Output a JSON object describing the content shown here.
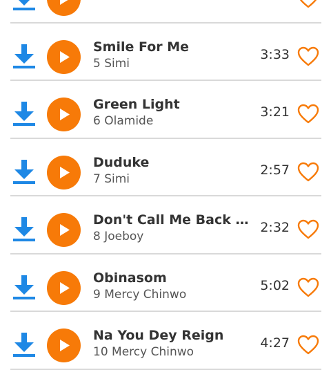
{
  "colors": {
    "accent": "#f77a08",
    "download_blue": "#1e88e5",
    "title_text": "#333333",
    "sub_text": "#555555"
  },
  "icons": {
    "download": "download-icon",
    "play": "play-icon",
    "favorite": "heart-outline-icon"
  },
  "tracks": [
    {
      "title": "",
      "number": "",
      "artist": "",
      "duration": ""
    },
    {
      "title": "Smile For Me",
      "number": "5",
      "artist": "Simi",
      "duration": "3:33"
    },
    {
      "title": "Green Light",
      "number": "6",
      "artist": "Olamide",
      "duration": "3:21"
    },
    {
      "title": "Duduke",
      "number": "7",
      "artist": "Simi",
      "duration": "2:57"
    },
    {
      "title": "Don't Call Me Back f...",
      "number": "8",
      "artist": "Joeboy",
      "duration": "2:32"
    },
    {
      "title": "Obinasom",
      "number": "9",
      "artist": "Mercy Chinwo",
      "duration": "5:02"
    },
    {
      "title": "Na You Dey Reign",
      "number": "10",
      "artist": "Mercy Chinwo",
      "duration": "4:27"
    }
  ]
}
